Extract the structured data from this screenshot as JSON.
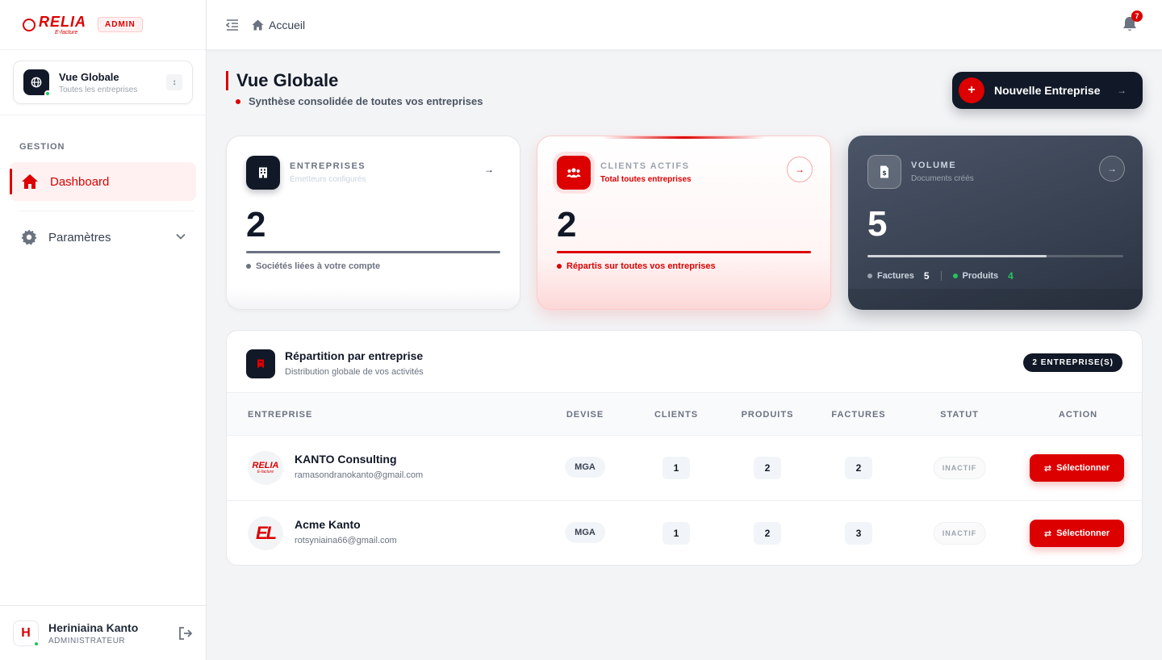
{
  "brand": {
    "logo_text": "RELIA",
    "logo_sub": "E-facture",
    "badge": "ADMIN"
  },
  "scope": {
    "title": "Vue Globale",
    "subtitle": "Toutes les entreprises"
  },
  "nav": {
    "heading": "GESTION",
    "items": [
      {
        "label": "Dashboard",
        "icon": "home-icon",
        "active": true
      },
      {
        "label": "Paramètres",
        "icon": "gear-icon",
        "active": false
      }
    ]
  },
  "user": {
    "initial": "H",
    "name": "Heriniaina Kanto",
    "role": "ADMINISTRATEUR"
  },
  "topbar": {
    "breadcrumb": "Accueil",
    "notifications": "7"
  },
  "header": {
    "title": "Vue Globale",
    "subtitle": "Synthèse consolidée de toutes vos entreprises",
    "new_button": "Nouvelle Entreprise"
  },
  "cards": [
    {
      "title": "ENTREPRISES",
      "subtitle": "Émetteurs configurés",
      "value": "2",
      "footer": "Sociétés liées à votre compte"
    },
    {
      "title": "CLIENTS ACTIFS",
      "subtitle": "Total toutes entreprises",
      "value": "2",
      "footer": "Répartis sur toutes vos entreprises"
    },
    {
      "title": "VOLUME",
      "subtitle": "Documents créés",
      "value": "5",
      "progress": 0.7,
      "factures_label": "Factures",
      "factures_value": "5",
      "produits_label": "Produits",
      "produits_value": "4"
    }
  ],
  "table": {
    "title": "Répartition par entreprise",
    "subtitle": "Distribution globale de vos activités",
    "count_badge": "2 ENTREPRISE(S)",
    "columns": [
      "ENTREPRISE",
      "DEVISE",
      "CLIENTS",
      "PRODUITS",
      "FACTURES",
      "STATUT",
      "ACTION"
    ],
    "rows": [
      {
        "logo_text": "RELIA",
        "logo_sub": "E-facture",
        "name": "KANTO Consulting",
        "email": "ramasondranokanto@gmail.com",
        "devise": "MGA",
        "clients": "1",
        "produits": "2",
        "factures": "2",
        "statut": "INACTIF",
        "action": "Sélectionner"
      },
      {
        "logo_text": "EL",
        "name": "Acme Kanto",
        "email": "rotsyniaina66@gmail.com",
        "devise": "MGA",
        "clients": "1",
        "produits": "2",
        "factures": "3",
        "statut": "INACTIF",
        "action": "Sélectionner"
      }
    ]
  },
  "colors": {
    "accent": "#dc0000",
    "dark": "#111827",
    "success": "#22c55e"
  }
}
